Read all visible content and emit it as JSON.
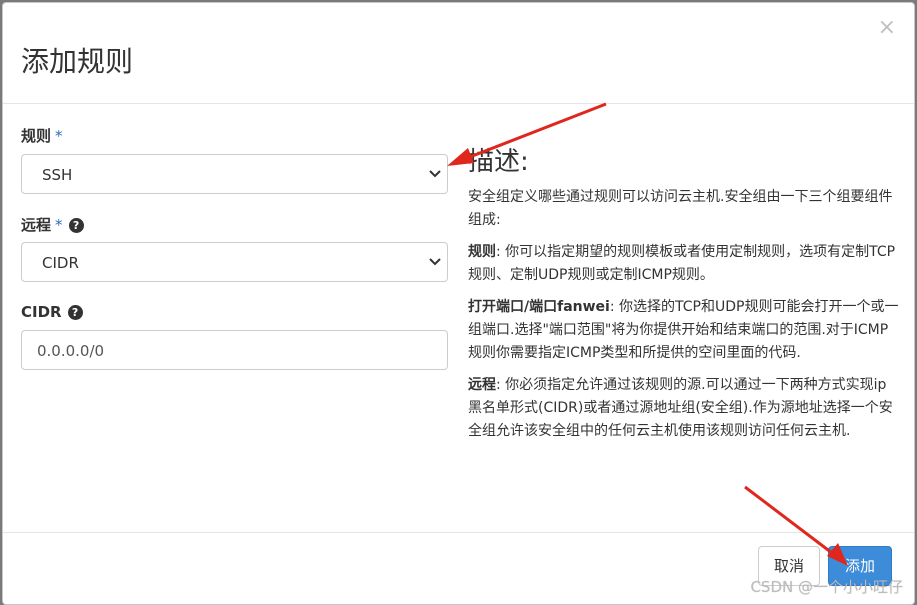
{
  "dialog": {
    "title": "添加规则",
    "close_glyph": "×"
  },
  "form": {
    "rule": {
      "label": "规则",
      "required_mark": "*",
      "value": "SSH"
    },
    "remote": {
      "label": "远程",
      "required_mark": "*",
      "help_glyph": "?",
      "value": "CIDR"
    },
    "cidr": {
      "label": "CIDR",
      "help_glyph": "?",
      "value": "0.0.0.0/0"
    }
  },
  "description": {
    "heading": "描述:",
    "intro": "安全组定义哪些通过规则可以访问云主机.安全组由一下三个组要组件组成:",
    "rule_term": "规则",
    "rule_text": ": 你可以指定期望的规则模板或者使用定制规则，选项有定制TCP规则、定制UDP规则或定制ICMP规则。",
    "port_term": "打开端口/端口fanwei",
    "port_text": ": 你选择的TCP和UDP规则可能会打开一个或一组端口.选择\"端口范围\"将为你提供开始和结束端口的范围.对于ICMP规则你需要指定ICMP类型和所提供的空间里面的代码.",
    "remote_term": "远程",
    "remote_text": ": 你必须指定允许通过该规则的源.可以通过一下两种方式实现ip黑名单形式(CIDR)或者通过源地址组(安全组).作为源地址选择一个安全组允许该安全组中的任何云主机使用该规则访问任何云主机."
  },
  "footer": {
    "cancel_label": "取消",
    "add_label": "添加"
  },
  "watermark": "CSDN @一个小小旺仔",
  "colors": {
    "primary": "#3d8cd9",
    "required": "#2a6ebb",
    "annotation_arrow": "#e0271d"
  },
  "icons": {
    "select_chevron": "chevron-down-icon",
    "help": "question-circle-icon",
    "close": "close-icon"
  }
}
